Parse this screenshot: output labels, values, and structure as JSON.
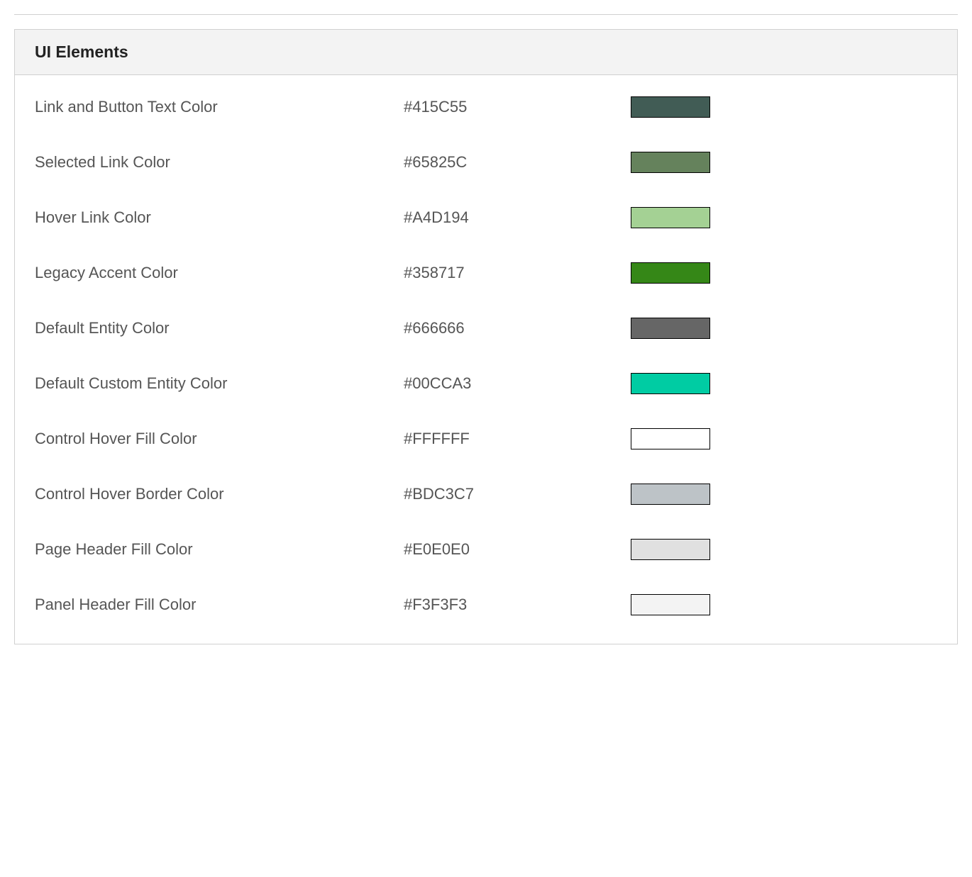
{
  "panel": {
    "title": "UI Elements",
    "rows": [
      {
        "label": "Link and Button Text Color",
        "value": "#415C55",
        "color": "#415C55"
      },
      {
        "label": "Selected Link Color",
        "value": "#65825C",
        "color": "#65825C"
      },
      {
        "label": "Hover Link Color",
        "value": "#A4D194",
        "color": "#A4D194"
      },
      {
        "label": "Legacy Accent Color",
        "value": "#358717",
        "color": "#358717"
      },
      {
        "label": "Default Entity Color",
        "value": "#666666",
        "color": "#666666"
      },
      {
        "label": "Default Custom Entity Color",
        "value": "#00CCA3",
        "color": "#00CCA3"
      },
      {
        "label": "Control Hover Fill Color",
        "value": "#FFFFFF",
        "color": "#FFFFFF"
      },
      {
        "label": "Control Hover Border Color",
        "value": "#BDC3C7",
        "color": "#BDC3C7"
      },
      {
        "label": "Page Header Fill Color",
        "value": "#E0E0E0",
        "color": "#E0E0E0"
      },
      {
        "label": "Panel Header Fill Color",
        "value": "#F3F3F3",
        "color": "#F3F3F3"
      }
    ]
  }
}
